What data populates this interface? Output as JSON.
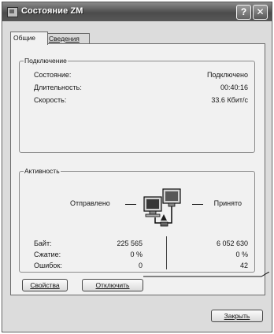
{
  "window": {
    "title": "Состояние ZM",
    "help_glyph": "?",
    "close_glyph": "✕"
  },
  "tabs": [
    {
      "label": "Общие"
    },
    {
      "label": "Сведения"
    }
  ],
  "connection": {
    "legend": "Подключение",
    "rows": [
      {
        "label": "Состояние:",
        "value": "Подключено"
      },
      {
        "label": "Длительность:",
        "value": "00:40:16"
      },
      {
        "label": "Скорость:",
        "value": "33.6 Кбит/с"
      }
    ]
  },
  "activity": {
    "legend": "Активность",
    "sent_label": "Отправлено",
    "received_label": "Принято",
    "stats": [
      {
        "label": "Байт:",
        "sent": "225 565",
        "received": "6 052 630"
      },
      {
        "label": "Сжатие:",
        "sent": "0 %",
        "received": "0 %"
      },
      {
        "label": "Ошибок:",
        "sent": "0",
        "received": "42"
      }
    ]
  },
  "buttons": {
    "properties": "Свойства",
    "disconnect": "Отключить",
    "close": "Закрыть"
  },
  "icons": [
    "network-connection-icon",
    "help-icon",
    "close-icon"
  ]
}
